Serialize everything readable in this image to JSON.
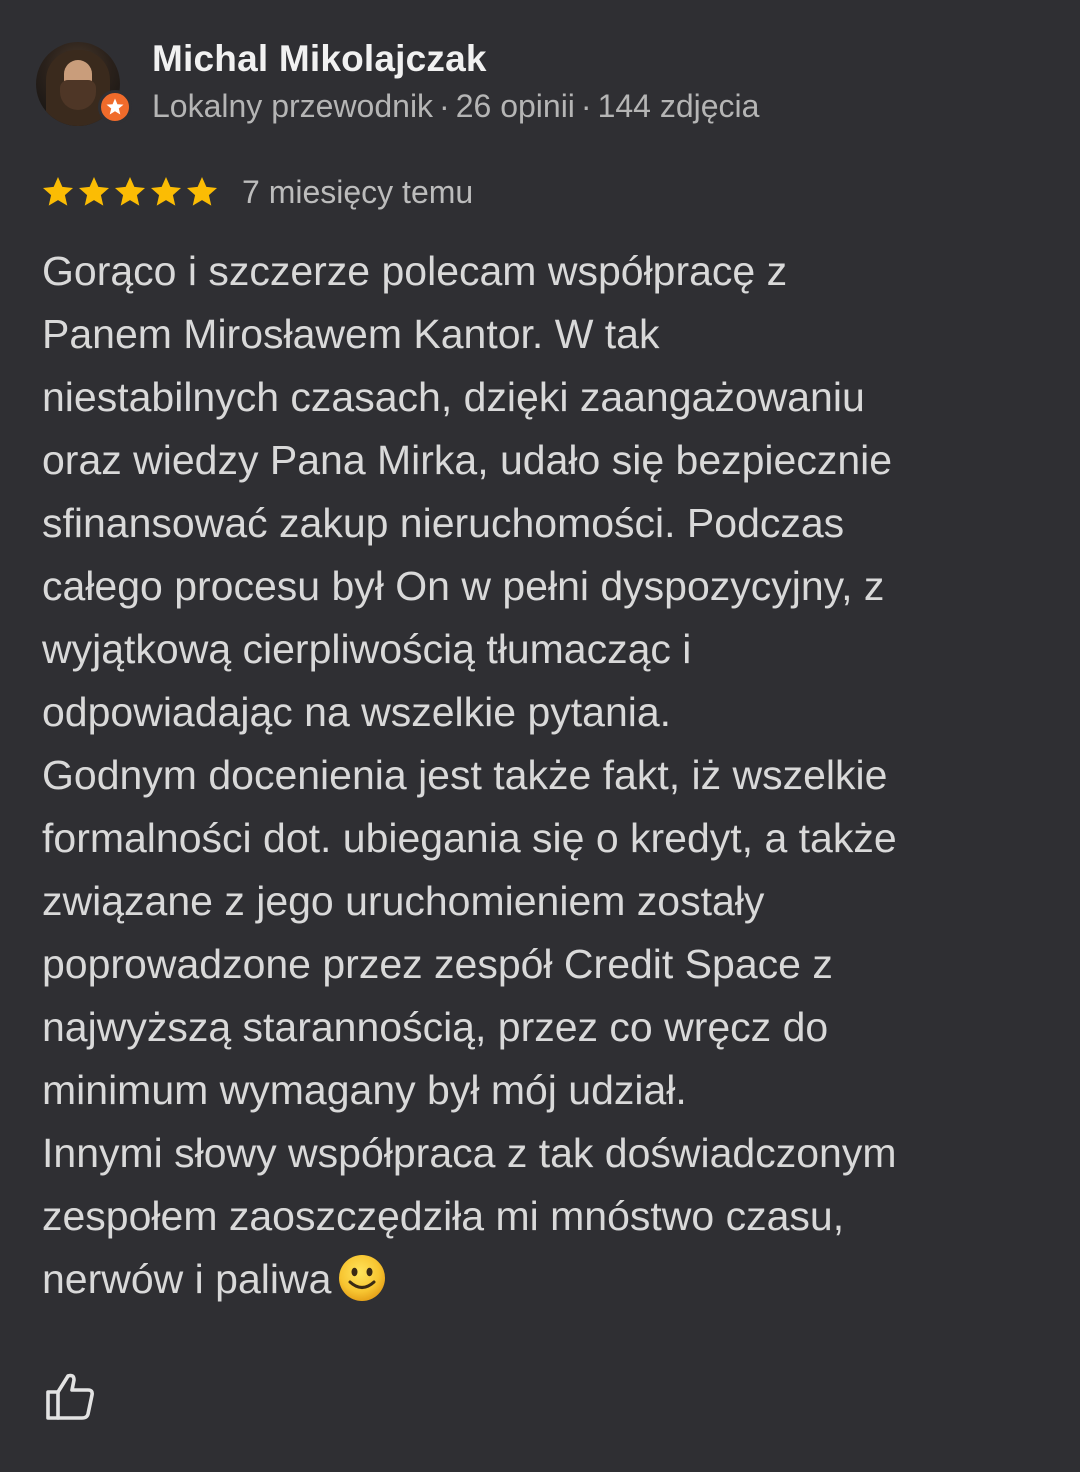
{
  "author": {
    "name": "Michal Mikolajczak",
    "role": "Lokalny przewodnik",
    "reviews": "26 opinii",
    "photos": "144 zdjęcia",
    "separator": "·"
  },
  "review": {
    "rating": 5,
    "rating_max": 5,
    "time_ago": "7 miesięcy temu",
    "text": "Gorąco i szczerze polecam współpracę z\nPanem Mirosławem Kantor. W tak\nniestabilnych czasach, dzięki zaangażowaniu\noraz wiedzy Pana Mirka, udało się bezpiecznie\nsfinansować zakup nieruchomości. Podczas\ncałego procesu był On w pełni dyspozycyjny, z\nwyjątkową cierpliwością tłumacząc i\nodpowiadając na wszelkie pytania.\nGodnym docenienia jest także fakt, iż wszelkie\nformalności dot. ubiegania się o kredyt, a także\nzwiązane z jego uruchomieniem zostały\npoprowadzone przez zespół Credit Space z\nnajwyższą starannością, przez co wręcz do\nminimum wymagany był mój udział.\nInnymi słowy współpraca z tak doświadczonym\nzespołem zaoszczędziła mi mnóstwo czasu,\nnerwów i paliwa"
  },
  "colors": {
    "background": "#2f2f33",
    "star": "#fbbc04",
    "guide_badge": "#f06b2b"
  },
  "icons": {
    "avatar": "avatar-photo",
    "badge": "local-guide-badge-icon",
    "star": "star-icon",
    "emoji": "smiling-face-emoji",
    "like": "thumbs-up-icon"
  }
}
